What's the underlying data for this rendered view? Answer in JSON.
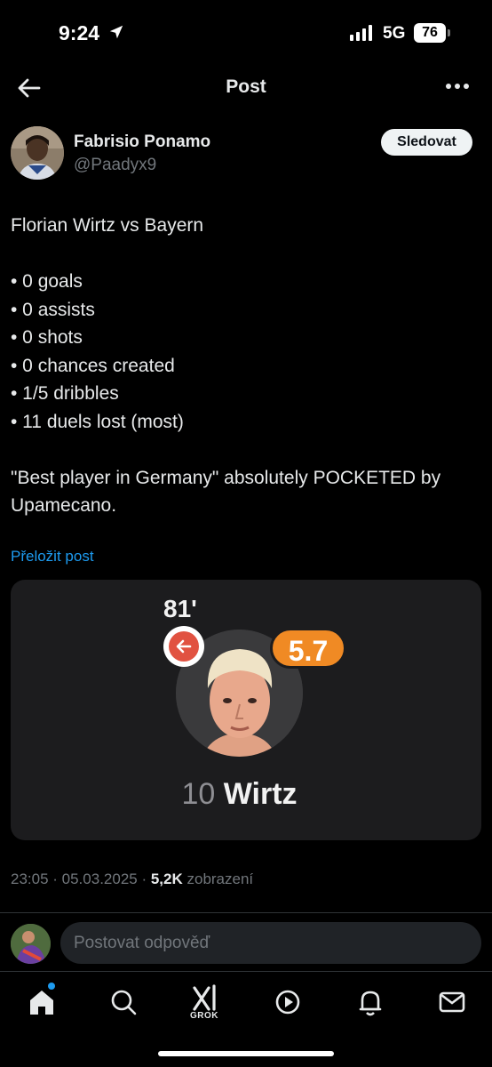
{
  "status_bar": {
    "time": "9:24",
    "network": "5G",
    "battery": "76"
  },
  "header": {
    "title": "Post"
  },
  "author": {
    "name": "Fabrisio Ponamo",
    "handle": "@Paadyx9",
    "follow_label": "Sledovat"
  },
  "post": {
    "headline": "Florian Wirtz vs Bayern",
    "stats": [
      "• 0 goals",
      "• 0 assists",
      "• 0 shots",
      "• 0 chances created",
      "• 1/5 dribbles",
      "• 11 duels lost (most)"
    ],
    "closing": "\"Best player in Germany\" absolutely POCKETED by Upamecano.",
    "translate_label": "Přeložit post"
  },
  "media": {
    "minute": "81'",
    "rating": "5.7",
    "player_number": "10",
    "player_name": "Wirtz"
  },
  "meta": {
    "timestamp": "23:05 · 05.03.2025 · ",
    "views_count": "5,2K",
    "views_label": " zobrazení"
  },
  "reply": {
    "placeholder": "Postovat odpověď"
  },
  "nav": {
    "grok_label": "GROK",
    "icons": [
      "home-icon",
      "search-icon",
      "grok-icon",
      "video-icon",
      "notifications-icon",
      "messages-icon"
    ]
  },
  "colors": {
    "accent": "#1d9bf0",
    "rating": "#f08a24",
    "substitution": "#e15241"
  }
}
